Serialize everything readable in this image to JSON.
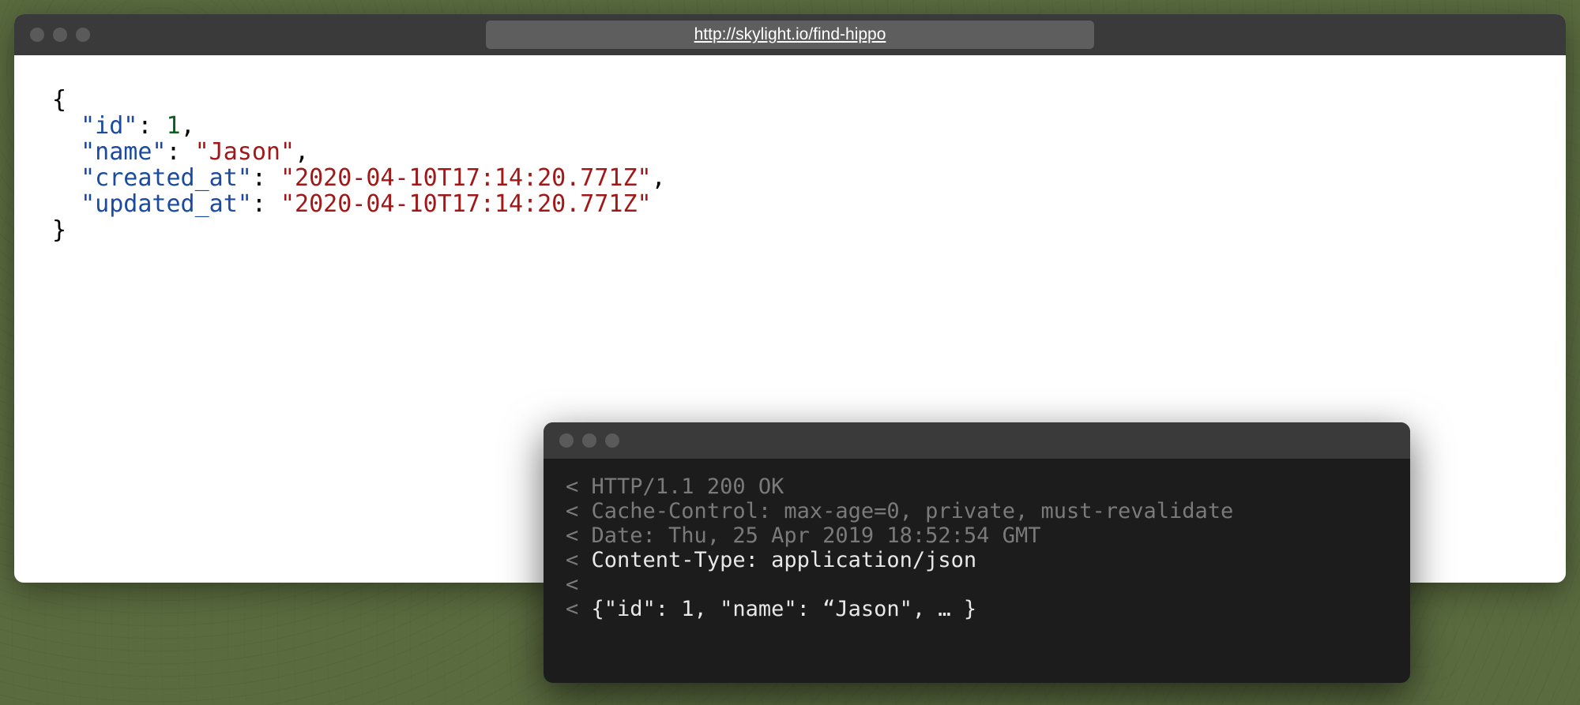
{
  "browser": {
    "url": "http://skylight.io/find-hippo",
    "json": {
      "key_id": "\"id\"",
      "val_id": "1",
      "key_name": "\"name\"",
      "val_name": "\"Jason\"",
      "key_created": "\"created_at\"",
      "val_created": "\"2020-04-10T17:14:20.771Z\"",
      "key_updated": "\"updated_at\"",
      "val_updated": "\"2020-04-10T17:14:20.771Z\""
    }
  },
  "terminal": {
    "line1_prefix": "< ",
    "line1": "HTTP/1.1 200 OK",
    "line2_prefix": "< ",
    "line2": "Cache-Control: max-age=0, private, must-revalidate",
    "line3_prefix": "< ",
    "line3": "Date: Thu, 25 Apr 2019 18:52:54 GMT",
    "line4_prefix": "< ",
    "line4": "Content-Type: application/json",
    "line5": "<",
    "line6_prefix": "< ",
    "line6": "{\"id\": 1, \"name\": “Jason\", … }"
  }
}
